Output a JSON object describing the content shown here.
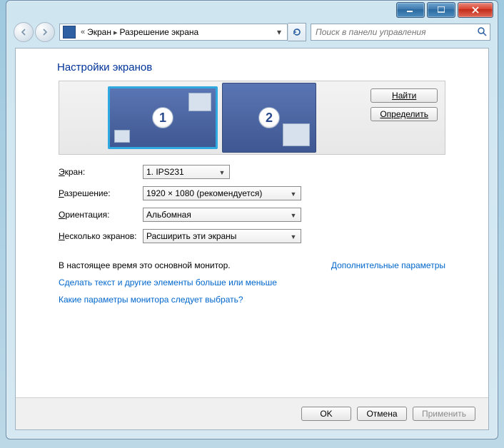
{
  "breadcrumb": {
    "item1": "Экран",
    "item2": "Разрешение экрана"
  },
  "search": {
    "placeholder": "Поиск в панели управления"
  },
  "heading": "Настройки экранов",
  "monitors": {
    "m1": "1",
    "m2": "2"
  },
  "preview_buttons": {
    "find": "Найти",
    "identify": "Определить"
  },
  "labels": {
    "screen": "кран:",
    "resolution": "азрешение:",
    "orientation": "риентация:",
    "multi": "есколько экранов:"
  },
  "underlines": {
    "screen": "Э",
    "resolution": "Р",
    "orientation": "О",
    "multi": "Н"
  },
  "values": {
    "screen": "1. IPS231",
    "resolution": "1920 × 1080 (рекомендуется)",
    "orientation": "Альбомная",
    "multi": "Расширить эти экраны"
  },
  "status": "В настоящее время это основной монитор.",
  "adv_link": "Дополнительные параметры",
  "link1": "Сделать текст и другие элементы больше или меньше",
  "link2": "Какие параметры монитора следует выбрать?",
  "buttons": {
    "ok": "OK",
    "cancel": "Отмена",
    "apply": "Применить"
  }
}
